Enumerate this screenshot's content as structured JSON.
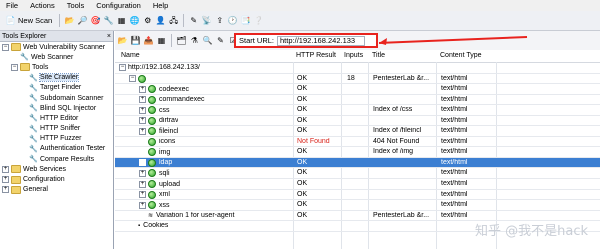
{
  "menu": [
    "File",
    "Actions",
    "Tools",
    "Configuration",
    "Help"
  ],
  "toolbar": {
    "new_scan": "New Scan"
  },
  "left_panel": {
    "title": "Tools Explorer",
    "close": "×",
    "tree": [
      {
        "label": "Web Vulnerability Scanner",
        "indent": 0,
        "exp": "−",
        "kind": "folder"
      },
      {
        "label": "Web Scanner",
        "indent": 1,
        "exp": "",
        "kind": "tool"
      },
      {
        "label": "Tools",
        "indent": 1,
        "exp": "−",
        "kind": "folder"
      },
      {
        "label": "Site Crawler",
        "indent": 2,
        "exp": "",
        "kind": "tool",
        "selected": true
      },
      {
        "label": "Target Finder",
        "indent": 2,
        "exp": "",
        "kind": "tool"
      },
      {
        "label": "Subdomain Scanner",
        "indent": 2,
        "exp": "",
        "kind": "tool"
      },
      {
        "label": "Blind SQL Injector",
        "indent": 2,
        "exp": "",
        "kind": "tool"
      },
      {
        "label": "HTTP Editor",
        "indent": 2,
        "exp": "",
        "kind": "tool"
      },
      {
        "label": "HTTP Sniffer",
        "indent": 2,
        "exp": "",
        "kind": "tool"
      },
      {
        "label": "HTTP Fuzzer",
        "indent": 2,
        "exp": "",
        "kind": "tool"
      },
      {
        "label": "Authentication Tester",
        "indent": 2,
        "exp": "",
        "kind": "tool"
      },
      {
        "label": "Compare Results",
        "indent": 2,
        "exp": "",
        "kind": "tool"
      },
      {
        "label": "Web Services",
        "indent": 0,
        "exp": "+",
        "kind": "folder"
      },
      {
        "label": "Configuration",
        "indent": 0,
        "exp": "+",
        "kind": "folder"
      },
      {
        "label": "General",
        "indent": 0,
        "exp": "+",
        "kind": "folder"
      }
    ]
  },
  "start_url": {
    "label": "Start URL:",
    "value": "http://192.168.242.133"
  },
  "columns": {
    "name": "Name",
    "http": "HTTP Result",
    "inputs": "Inputs",
    "title": "Title",
    "content": "Content Type"
  },
  "rows": [
    {
      "name": "http://192.168.242.133/",
      "indent": 0,
      "exp": "−",
      "icon": "none",
      "http": "",
      "inputs": "",
      "title": "",
      "content": ""
    },
    {
      "name": "",
      "indent": 1,
      "exp": "−",
      "icon": "globe",
      "http": "OK",
      "inputs": "18",
      "title": "PentesterLab &r...",
      "content": "text/html"
    },
    {
      "name": "codeexec",
      "indent": 2,
      "exp": "+",
      "icon": "globe",
      "http": "OK",
      "inputs": "",
      "title": "",
      "content": "text/html"
    },
    {
      "name": "commandexec",
      "indent": 2,
      "exp": "+",
      "icon": "globe",
      "http": "OK",
      "inputs": "",
      "title": "",
      "content": "text/html"
    },
    {
      "name": "css",
      "indent": 2,
      "exp": "+",
      "icon": "globe",
      "http": "OK",
      "inputs": "",
      "title": "Index of /css",
      "content": "text/html"
    },
    {
      "name": "dirtrav",
      "indent": 2,
      "exp": "+",
      "icon": "globe",
      "http": "OK",
      "inputs": "",
      "title": "",
      "content": "text/html"
    },
    {
      "name": "fileincl",
      "indent": 2,
      "exp": "+",
      "icon": "globe",
      "http": "OK",
      "inputs": "",
      "title": "Index of /fileincl",
      "content": "text/html"
    },
    {
      "name": "icons",
      "indent": 2,
      "exp": "",
      "icon": "globe",
      "http": "Not Found",
      "http_err": true,
      "inputs": "",
      "title": "404 Not Found",
      "content": "text/html"
    },
    {
      "name": "img",
      "indent": 2,
      "exp": "",
      "icon": "globe",
      "http": "OK",
      "inputs": "",
      "title": "Index of /img",
      "content": "text/html"
    },
    {
      "name": "ldap",
      "indent": 2,
      "exp": "+",
      "icon": "globe",
      "http": "OK",
      "inputs": "",
      "title": "",
      "content": "text/html",
      "selected": true
    },
    {
      "name": "sqli",
      "indent": 2,
      "exp": "+",
      "icon": "globe",
      "http": "OK",
      "inputs": "",
      "title": "",
      "content": "text/html"
    },
    {
      "name": "upload",
      "indent": 2,
      "exp": "+",
      "icon": "globe",
      "http": "OK",
      "inputs": "",
      "title": "",
      "content": "text/html"
    },
    {
      "name": "xml",
      "indent": 2,
      "exp": "+",
      "icon": "globe",
      "http": "OK",
      "inputs": "",
      "title": "",
      "content": "text/html"
    },
    {
      "name": "xss",
      "indent": 2,
      "exp": "+",
      "icon": "globe",
      "http": "OK",
      "inputs": "",
      "title": "",
      "content": "text/html"
    },
    {
      "name": "Variation 1 for user-agent",
      "indent": 2,
      "exp": "",
      "icon": "var",
      "http": "OK",
      "inputs": "",
      "title": "PentesterLab &r...",
      "content": "text/html"
    },
    {
      "name": "Cookies",
      "indent": 1,
      "exp": "",
      "icon": "cookie",
      "http": "",
      "inputs": "",
      "title": "",
      "content": ""
    }
  ],
  "watermark": "知乎 @我不是hack",
  "colors": {
    "highlight_box": "#e8231e",
    "selection": "#3c7fd2",
    "not_found": "#d9251c"
  }
}
